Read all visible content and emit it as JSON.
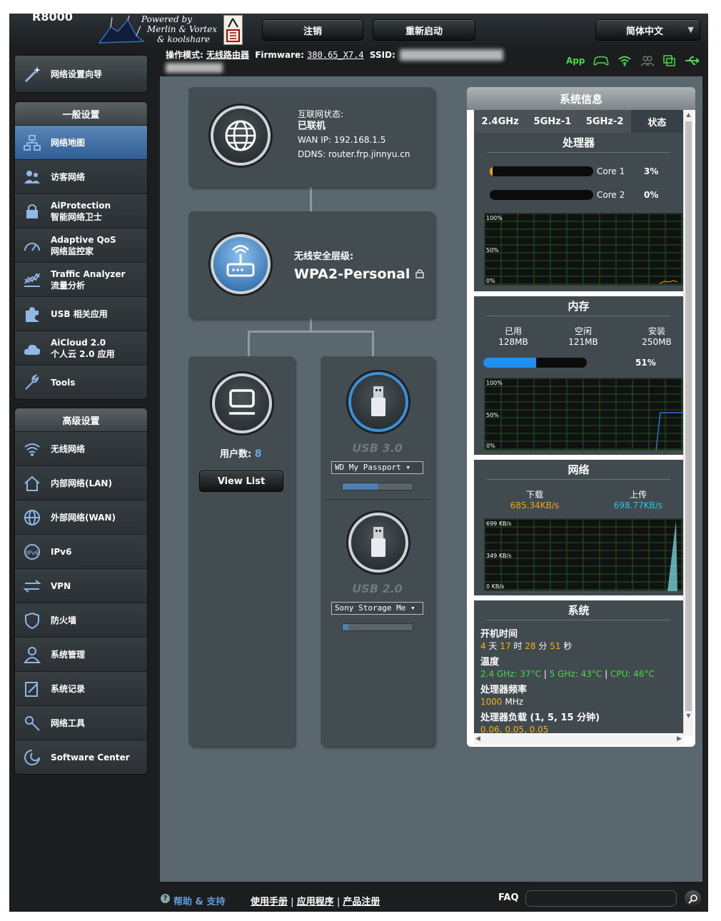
{
  "header": {
    "model": "R8000",
    "logo_text": [
      "Powered by",
      "Merlin & Vortex",
      "& koolshare"
    ],
    "logout": "注销",
    "reboot": "重新启动",
    "language": "简体中文",
    "op_mode_label": "操作模式:",
    "op_mode_value": "无线路由器",
    "firmware_label": "Firmware:",
    "firmware_value": "380.65_X7.4",
    "ssid_label": "SSID:",
    "app_label": "App"
  },
  "sidebar": {
    "wizard": "网络设置向导",
    "general_title": "一般设置",
    "general": [
      {
        "line1": "网络地图",
        "icon": "network-map-icon"
      },
      {
        "line1": "访客网络",
        "icon": "guest-network-icon"
      },
      {
        "line1": "AiProtection",
        "line2": "智能网络卫士",
        "icon": "lock-icon"
      },
      {
        "line1": "Adaptive QoS",
        "line2": "网络监控家",
        "icon": "gauge-icon"
      },
      {
        "line1": "Traffic Analyzer",
        "line2": "流量分析",
        "icon": "traffic-icon"
      },
      {
        "line1": "USB 相关应用",
        "icon": "puzzle-icon"
      },
      {
        "line1": "AiCloud 2.0",
        "line2": "个人云 2.0 应用",
        "icon": "cloud-icon"
      },
      {
        "line1": "Tools",
        "icon": "wrench-icon"
      }
    ],
    "advanced_title": "高级设置",
    "advanced": [
      {
        "line1": "无线网络",
        "icon": "wifi-icon"
      },
      {
        "line1": "内部网络(LAN)",
        "icon": "home-icon"
      },
      {
        "line1": "外部网络(WAN)",
        "icon": "globe-icon"
      },
      {
        "line1": "IPv6",
        "icon": "ipv6-icon"
      },
      {
        "line1": "VPN",
        "icon": "vpn-icon"
      },
      {
        "line1": "防火墙",
        "icon": "shield-icon"
      },
      {
        "line1": "系统管理",
        "icon": "user-icon"
      },
      {
        "line1": "系统记录",
        "icon": "log-icon"
      },
      {
        "line1": "网络工具",
        "icon": "tools-icon"
      },
      {
        "line1": "Software Center",
        "icon": "software-icon"
      }
    ]
  },
  "map": {
    "internet_label": "互联网状态:",
    "internet_status": "已联机",
    "wan_ip": "WAN IP: 192.168.1.5",
    "ddns": "DDNS: router.frp.jinnyu.cn",
    "security_label": "无线安全层级:",
    "security_value": "WPA2-Personal",
    "clients_label": "用户数:",
    "clients_count": "8",
    "view_list": "View List",
    "usb3_label": "USB 3.0",
    "usb3_device": "WD My Passport ▾",
    "usb3_usage": 0.5,
    "usb2_label": "USB 2.0",
    "usb2_device": "Sony Storage Me ▾",
    "usb2_usage": 0.08
  },
  "sysinfo": {
    "title": "系统信息",
    "tabs": [
      "2.4GHz",
      "5GHz-1",
      "5GHz-2",
      "状态"
    ],
    "cpu_title": "处理器",
    "core1_label": "Core 1",
    "core1_value": "3%",
    "core1_level": 0.03,
    "core2_label": "Core 2",
    "core2_value": "0%",
    "core2_level": 0,
    "cpu_axis": [
      "100%",
      "50%",
      "0%"
    ],
    "mem_title": "内存",
    "used_label": "已用",
    "used_value": "128MB",
    "free_label": "空闲",
    "free_value": "121MB",
    "total_label": "安装",
    "total_value": "250MB",
    "mem_percent": "51%",
    "mem_level": 0.51,
    "mem_axis": [
      "100%",
      "50%",
      "0%"
    ],
    "net_title": "网络",
    "down_label": "下载",
    "down_value": "685.34KB/s",
    "up_label": "上传",
    "up_value": "698.77KB/s",
    "net_axis": [
      "699 KB/s",
      "349 KB/s",
      "0 KB/s"
    ],
    "sys_title": "系统",
    "uptime_label": "开机时间",
    "uptime_d": "4",
    "uptime_d_unit": "天",
    "uptime_h": "17",
    "uptime_h_unit": "时",
    "uptime_m": "28",
    "uptime_m_unit": "分",
    "uptime_s": "51",
    "uptime_s_unit": "秒",
    "temp_label": "温度",
    "temp_24": "2.4 GHz: 37°C",
    "temp_5": "5 GHz: 43°C",
    "temp_cpu": "CPU: 46°C",
    "sep": "|",
    "freq_label": "处理器频率",
    "freq_value": "1000",
    "freq_unit": "MHz",
    "load_label": "处理器负载 (1, 5, 15 分钟)",
    "load_value": "0.06,  0.05,  0.05"
  },
  "footer": {
    "help": "帮助 & 支持",
    "manual": "使用手册",
    "apps": "应用程序",
    "register": "产品注册",
    "sep": "|",
    "faq": "FAQ"
  },
  "colors": {
    "accent": "#4f7fb3",
    "gold": "#f6b316",
    "green": "#49d849",
    "cyan": "#2cc5e6"
  }
}
